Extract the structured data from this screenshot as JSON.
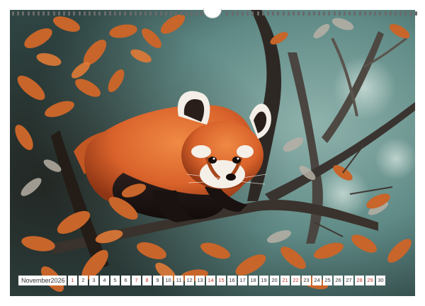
{
  "calendar": {
    "month": "November",
    "year": "2026",
    "days": [
      {
        "label": "1",
        "weekend": true
      },
      {
        "label": "2",
        "weekend": false
      },
      {
        "label": "3",
        "weekend": false
      },
      {
        "label": "4",
        "weekend": false
      },
      {
        "label": "5",
        "weekend": false
      },
      {
        "label": "6",
        "weekend": false
      },
      {
        "label": "7",
        "weekend": true
      },
      {
        "label": "8",
        "weekend": true
      },
      {
        "label": "9",
        "weekend": false
      },
      {
        "label": "10",
        "weekend": false
      },
      {
        "label": "11",
        "weekend": false
      },
      {
        "label": "12",
        "weekend": false
      },
      {
        "label": "13",
        "weekend": false
      },
      {
        "label": "14",
        "weekend": true
      },
      {
        "label": "15",
        "weekend": true
      },
      {
        "label": "16",
        "weekend": false
      },
      {
        "label": "17",
        "weekend": false
      },
      {
        "label": "18",
        "weekend": false
      },
      {
        "label": "19",
        "weekend": false
      },
      {
        "label": "20",
        "weekend": false
      },
      {
        "label": "21",
        "weekend": true
      },
      {
        "label": "22",
        "weekend": true
      },
      {
        "label": "23",
        "weekend": false
      },
      {
        "label": "24",
        "weekend": false
      },
      {
        "label": "25",
        "weekend": false
      },
      {
        "label": "26",
        "weekend": false
      },
      {
        "label": "27",
        "weekend": false
      },
      {
        "label": "28",
        "weekend": true
      },
      {
        "label": "29",
        "weekend": true
      },
      {
        "label": "30",
        "weekend": false
      }
    ]
  },
  "colors": {
    "weekend_text": "#c0392b",
    "weekday_text": "#333333",
    "panda_fur": "#d9622b",
    "foliage": "#c8652a",
    "background_teal": "#5f8a86"
  },
  "photo": {
    "subject": "red-panda",
    "setting": "autumn-tree-branches"
  }
}
